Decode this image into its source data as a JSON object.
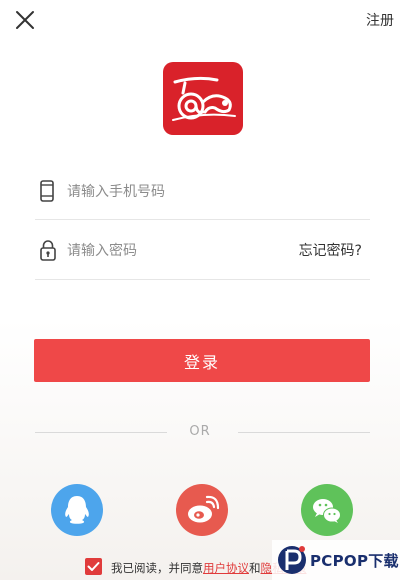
{
  "header": {
    "close_icon": "close-icon",
    "register_label": "注册"
  },
  "logo": {
    "icon": "app-logo",
    "brand_color": "#d9222a"
  },
  "form": {
    "phone_placeholder": "请输入手机号码",
    "phone_icon": "phone-icon",
    "password_placeholder": "请输入密码",
    "password_icon": "lock-icon",
    "forgot_label": "忘记密码?"
  },
  "login": {
    "label": "登录",
    "color": "#ef4848"
  },
  "divider": {
    "label": "OR"
  },
  "social": [
    {
      "name": "qq",
      "icon": "qq-icon",
      "color": "#4da5ec"
    },
    {
      "name": "weibo",
      "icon": "weibo-icon",
      "color": "#e75a4f"
    },
    {
      "name": "wechat",
      "icon": "wechat-icon",
      "color": "#5fc25a"
    }
  ],
  "agreement": {
    "checked": true,
    "prefix": "我已阅读，并同意",
    "user_agreement": "用户协议",
    "and": "和",
    "privacy_policy": "隐私政策"
  },
  "watermark": {
    "text": "PCPOP下载"
  }
}
